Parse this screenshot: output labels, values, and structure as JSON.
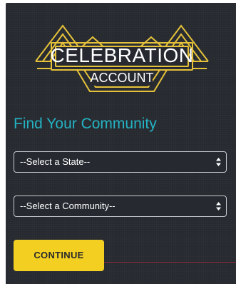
{
  "colors": {
    "panel_background": "#262a30",
    "gold": "#e6c23a",
    "heading": "#24b3c3",
    "button": "#f3cf22"
  },
  "logo": {
    "line1": "CELEBRATION",
    "line2": "ACCOUNT"
  },
  "form": {
    "heading": "Find Your Community",
    "state_select": {
      "value": "--Select a State--",
      "icon": "updown-arrows-icon"
    },
    "community_select": {
      "value": "--Select a Community--",
      "icon": "updown-arrows-icon"
    },
    "continue_label": "CONTINUE"
  }
}
